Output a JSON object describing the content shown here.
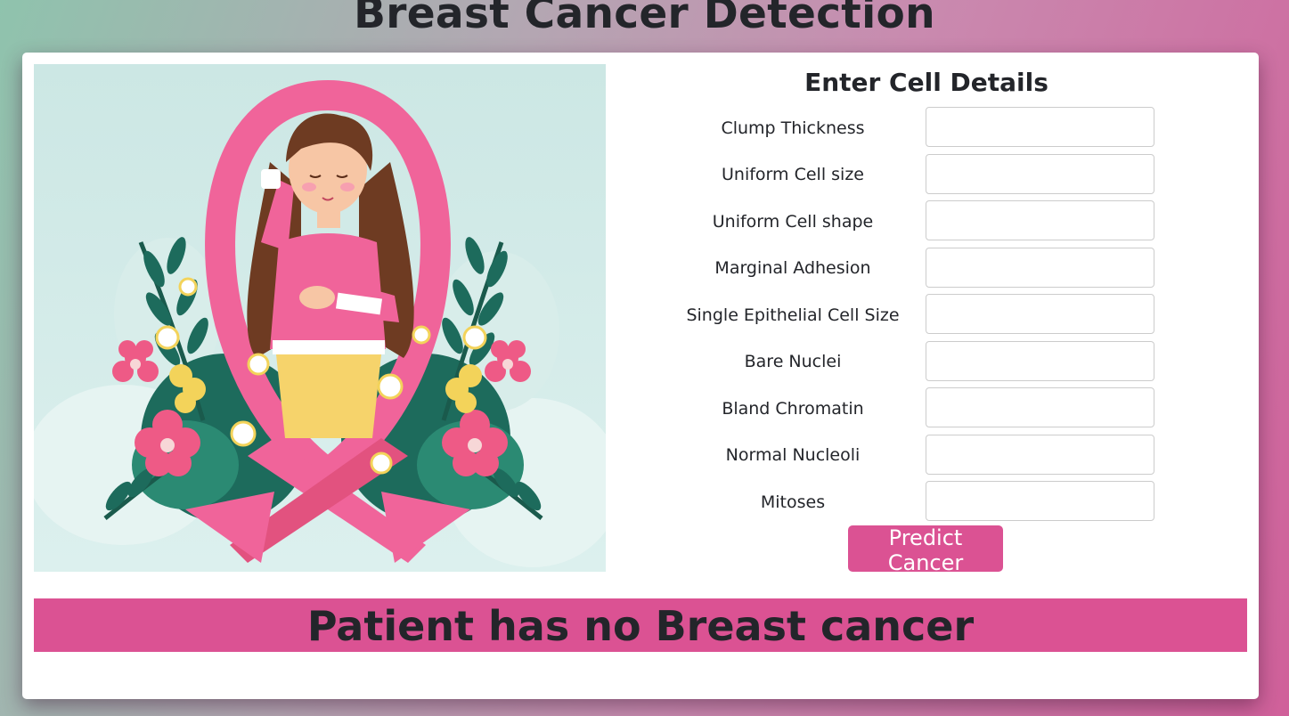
{
  "page": {
    "title": "Breast Cancer Detection"
  },
  "illustration": {
    "alt": "pink ribbon with woman and flowers",
    "icon": "breast-cancer-awareness-ribbon-illustration"
  },
  "form": {
    "heading": "Enter Cell Details",
    "fields": [
      {
        "label": "Clump Thickness",
        "value": "",
        "placeholder": ""
      },
      {
        "label": "Uniform Cell size",
        "value": "",
        "placeholder": ""
      },
      {
        "label": "Uniform Cell shape",
        "value": "",
        "placeholder": ""
      },
      {
        "label": "Marginal Adhesion",
        "value": "",
        "placeholder": ""
      },
      {
        "label": "Single Epithelial Cell Size",
        "value": "",
        "placeholder": ""
      },
      {
        "label": "Bare Nuclei",
        "value": "",
        "placeholder": ""
      },
      {
        "label": "Bland Chromatin",
        "value": "",
        "placeholder": ""
      },
      {
        "label": "Normal Nucleoli",
        "value": "",
        "placeholder": ""
      },
      {
        "label": "Mitoses",
        "value": "",
        "placeholder": ""
      }
    ],
    "submit_label": "Predict Cancer"
  },
  "result": {
    "text": "Patient has no Breast cancer"
  },
  "colors": {
    "accent": "#db5293",
    "text": "#23252a",
    "card": "#ffffff"
  }
}
